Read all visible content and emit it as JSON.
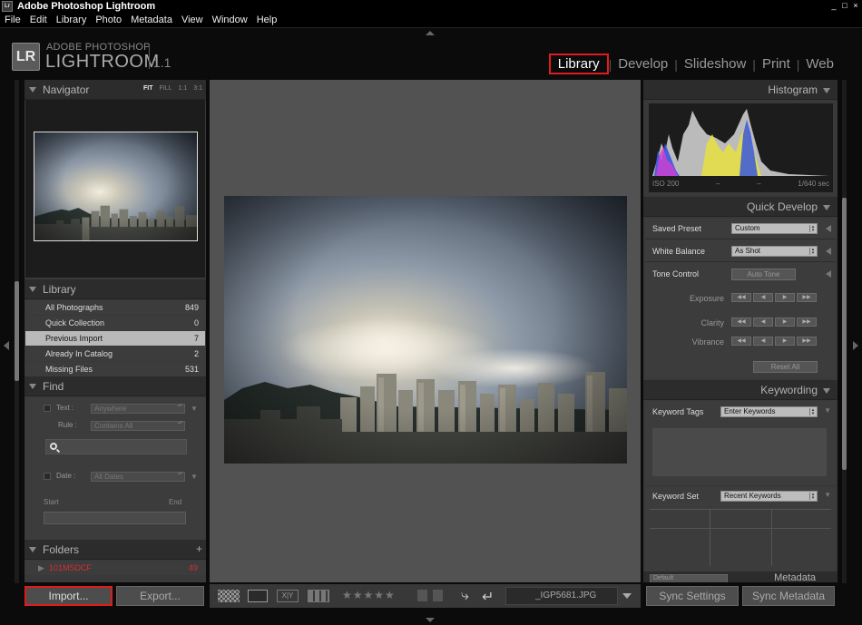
{
  "window": {
    "title": "Adobe Photoshop Lightroom",
    "app_icon": "Lr",
    "controls": [
      "_",
      "□",
      "×"
    ]
  },
  "menu": [
    "File",
    "Edit",
    "Library",
    "Photo",
    "Metadata",
    "View",
    "Window",
    "Help"
  ],
  "brand": {
    "badge": "LR",
    "line1": "ADOBE PHOTOSHOP",
    "line2": "LIGHTROOM",
    "version": "1.1"
  },
  "modules": {
    "library": "Library",
    "develop": "Develop",
    "slideshow": "Slideshow",
    "print": "Print",
    "web": "Web",
    "active": "Library"
  },
  "navigator": {
    "title": "Navigator",
    "opts": [
      "FIT",
      "FILL",
      "1:1",
      "3:1"
    ],
    "selected": "FIT"
  },
  "library": {
    "title": "Library",
    "items": [
      {
        "label": "All Photographs",
        "count": "849"
      },
      {
        "label": "Quick Collection",
        "count": "0"
      },
      {
        "label": "Previous Import",
        "count": "7"
      },
      {
        "label": "Already In Catalog",
        "count": "2"
      },
      {
        "label": "Missing Files",
        "count": "531"
      }
    ],
    "selected": "Previous Import"
  },
  "find": {
    "title": "Find",
    "text_label": "Text :",
    "text_value": "Anywhere",
    "rule_label": "Rule :",
    "rule_value": "Contains All",
    "date_label": "Date :",
    "date_value": "All Dates",
    "start_label": "Start",
    "end_label": "End"
  },
  "folders": {
    "title": "Folders",
    "add": "+",
    "items": [
      {
        "label": "101MSDCF",
        "count": "49"
      }
    ]
  },
  "left_buttons": {
    "import": "Import...",
    "export": "Export..."
  },
  "toolbar": {
    "filename": "_IGP5681.JPG",
    "rating_stars": "★★★★★",
    "survey_label": "X|Y"
  },
  "histogram": {
    "title": "Histogram",
    "iso": "ISO 200",
    "m1": "–",
    "m2": "–",
    "shutter": "1/640 sec"
  },
  "quick_develop": {
    "title": "Quick Develop",
    "saved_preset_label": "Saved Preset",
    "saved_preset_value": "Custom",
    "white_balance_label": "White Balance",
    "white_balance_value": "As Shot",
    "tone_control_label": "Tone Control",
    "auto_tone": "Auto Tone",
    "exposure": "Exposure",
    "clarity": "Clarity",
    "vibrance": "Vibrance",
    "reset": "Reset All",
    "arrows": [
      "◀◀",
      "◀",
      "▶",
      "▶▶"
    ]
  },
  "keywording": {
    "title": "Keywording",
    "tags_label": "Keyword Tags",
    "tags_value": "Enter Keywords",
    "set_label": "Keyword Set",
    "set_value": "Recent Keywords"
  },
  "metadata": {
    "title": "Metadata",
    "preset": "Default"
  },
  "right_buttons": {
    "sync_settings": "Sync Settings",
    "sync_metadata": "Sync Metadata"
  },
  "colors": {
    "active_outline": "#e01b1b",
    "folder_text": "#d43030",
    "panel_bg": "#393939",
    "center_bg": "#525252"
  }
}
